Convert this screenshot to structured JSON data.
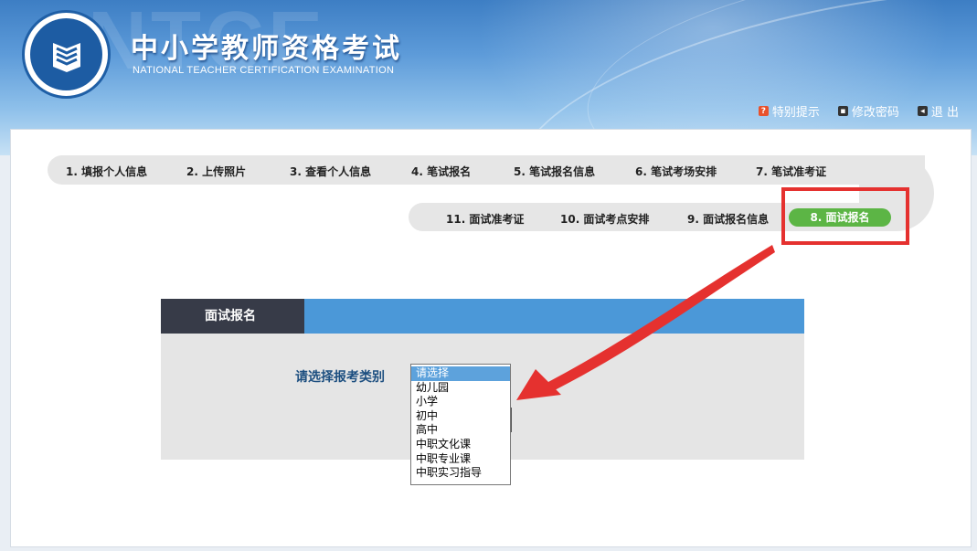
{
  "header": {
    "watermark": "NTCE",
    "title": "中小学教师资格考试",
    "subtitle": "NATIONAL TEACHER CERTIFICATION EXAMINATION",
    "logo_icon": "book-emblem-icon",
    "links": [
      {
        "label": "特别提示",
        "icon": "notice-icon",
        "color": "#e8522d"
      },
      {
        "label": "修改密码",
        "icon": "password-icon",
        "color": "#333333"
      },
      {
        "label": "退 出",
        "icon": "logout-icon",
        "color": "#333333"
      }
    ]
  },
  "nav": {
    "row1": [
      "1. 填报个人信息",
      "2. 上传照片",
      "3. 查看个人信息",
      "4. 笔试报名",
      "5. 笔试报名信息",
      "6. 笔试考场安排",
      "7. 笔试准考证"
    ],
    "row2": [
      "11. 面试准考证",
      "10. 面试考点安排",
      "9. 面试报名信息",
      "8. 面试报名"
    ],
    "active_index": 3,
    "active_color": "#5cb545"
  },
  "form": {
    "tab_title": "面试报名",
    "label": "请选择报考类别",
    "options": [
      "请选择",
      "幼儿园",
      "小学",
      "初中",
      "高中",
      "中职文化课",
      "中职专业课",
      "中职实习指导"
    ],
    "selected": "请选择"
  },
  "annotation": {
    "highlight_color": "#e5312f",
    "arrow_color": "#e5312f"
  }
}
